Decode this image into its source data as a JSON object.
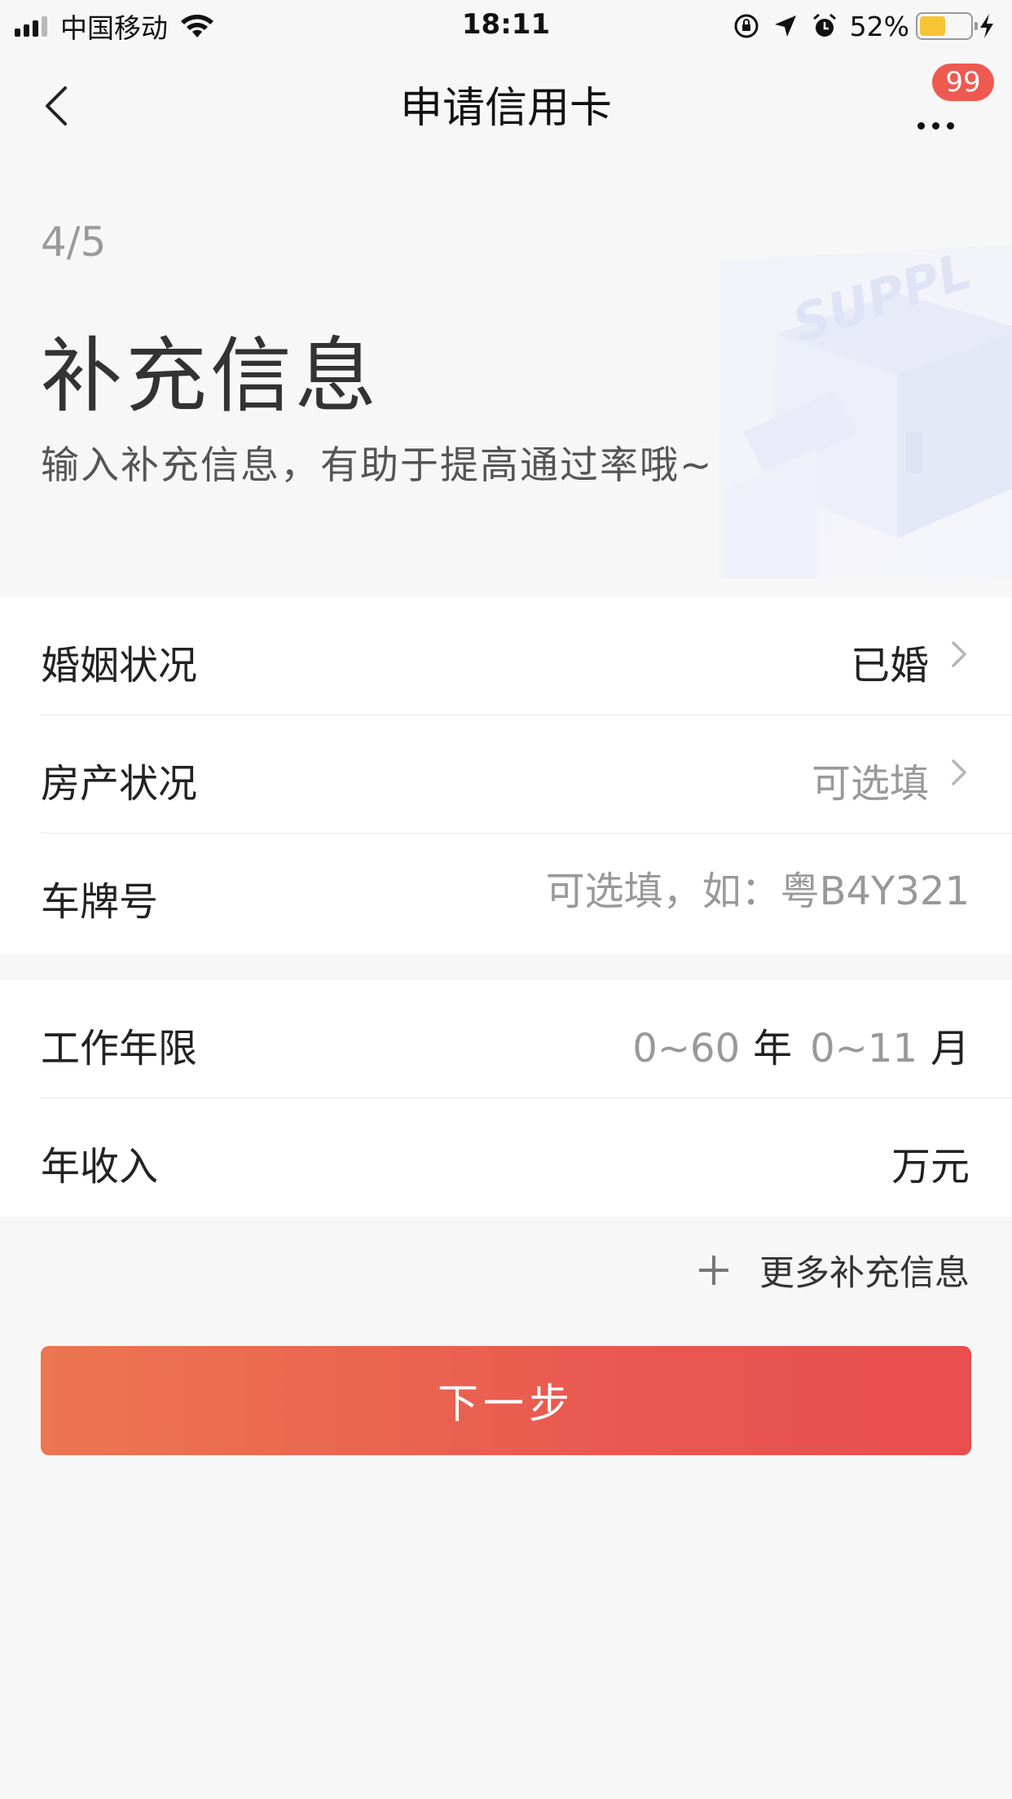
{
  "status_bar": {
    "carrier": "中国移动",
    "time": "18:11",
    "battery_percent": "52%",
    "battery_level": 0.52,
    "icons": [
      "signal-icon",
      "wifi-icon",
      "orientation-lock-icon",
      "location-icon",
      "alarm-icon",
      "battery-icon",
      "charging-icon"
    ]
  },
  "nav": {
    "back_icon": "chevron-left-icon",
    "title": "申请信用卡",
    "more_icon": "more-dots-icon",
    "badge_count": "99"
  },
  "header": {
    "step": "4/5",
    "title": "补充信息",
    "subtitle": "输入补充信息，有助于提高通过率哦~",
    "illustration_text": "SUPPL"
  },
  "form": {
    "marital_status": {
      "label": "婚姻状况",
      "value": "已婚"
    },
    "property_status": {
      "label": "房产状况",
      "placeholder": "可选填"
    },
    "license_plate": {
      "label": "车牌号",
      "placeholder": "可选填，如：粤B4Y321"
    },
    "work_years": {
      "label": "工作年限",
      "years_placeholder": "0~60",
      "years_unit": "年",
      "months_placeholder": "0~11",
      "months_unit": "月"
    },
    "annual_income": {
      "label": "年收入",
      "unit": "万元"
    }
  },
  "more_info": {
    "icon": "plus-icon",
    "label": "更多补充信息"
  },
  "next_button": {
    "label": "下一步"
  },
  "colors": {
    "background": "#f7f7f7",
    "primary_gradient_start": "#ec7651",
    "primary_gradient_end": "#e84e4e",
    "badge": "#ef5a50",
    "placeholder": "#999999"
  }
}
